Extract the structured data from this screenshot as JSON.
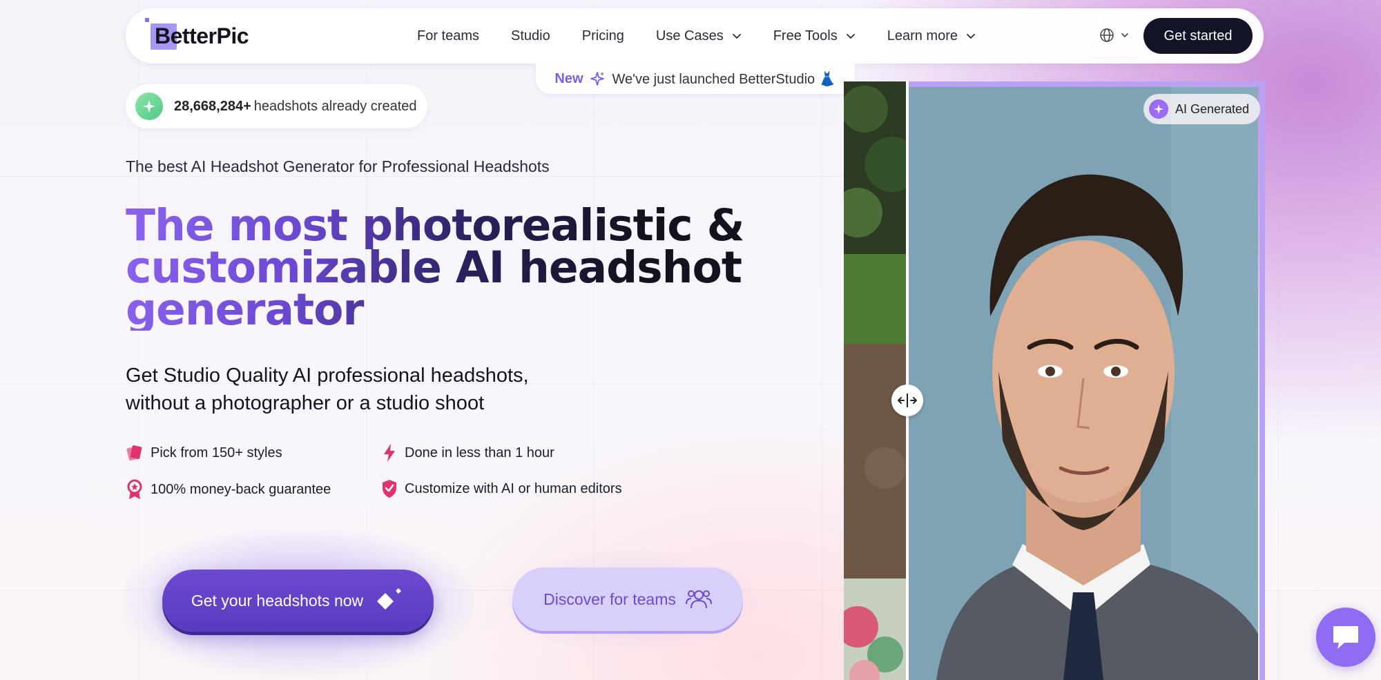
{
  "brand": {
    "name": "BetterPic"
  },
  "nav": {
    "items": [
      {
        "label": "For teams",
        "dropdown": false
      },
      {
        "label": "Studio",
        "dropdown": false
      },
      {
        "label": "Pricing",
        "dropdown": false
      },
      {
        "label": "Use Cases",
        "dropdown": true
      },
      {
        "label": "Free Tools",
        "dropdown": true
      },
      {
        "label": "Learn more",
        "dropdown": true
      }
    ],
    "language_icon": "globe-icon",
    "cta_label": "Get started"
  },
  "announcement": {
    "tag": "New",
    "text": "We've just launched BetterStudio 👗"
  },
  "counter": {
    "number": "28,668,284+",
    "text": "headshots already created"
  },
  "hero": {
    "kicker": "The best AI Headshot Generator for Professional Headshots",
    "headline": "The most photorealistic & customizable AI headshot generator",
    "subhead_line1": "Get Studio Quality AI professional headshots,",
    "subhead_line2": "without a photographer or a studio shoot"
  },
  "features": [
    {
      "text": "Pick from 150+ styles",
      "icon": "styles-icon"
    },
    {
      "text": "Done in less than 1 hour",
      "icon": "lightning-icon"
    },
    {
      "text": "100% money-back guarantee",
      "icon": "badge-icon"
    },
    {
      "text": "Customize with AI or human editors",
      "icon": "shield-check-icon"
    }
  ],
  "cta": {
    "primary": "Get your headshots now",
    "secondary": "Discover for teams"
  },
  "comparison": {
    "badge": "AI Generated"
  },
  "colors": {
    "accent": "#6b4ad1",
    "accent_light": "#d9cffb",
    "dark": "#111526",
    "feature_icon": "#e0336e"
  }
}
